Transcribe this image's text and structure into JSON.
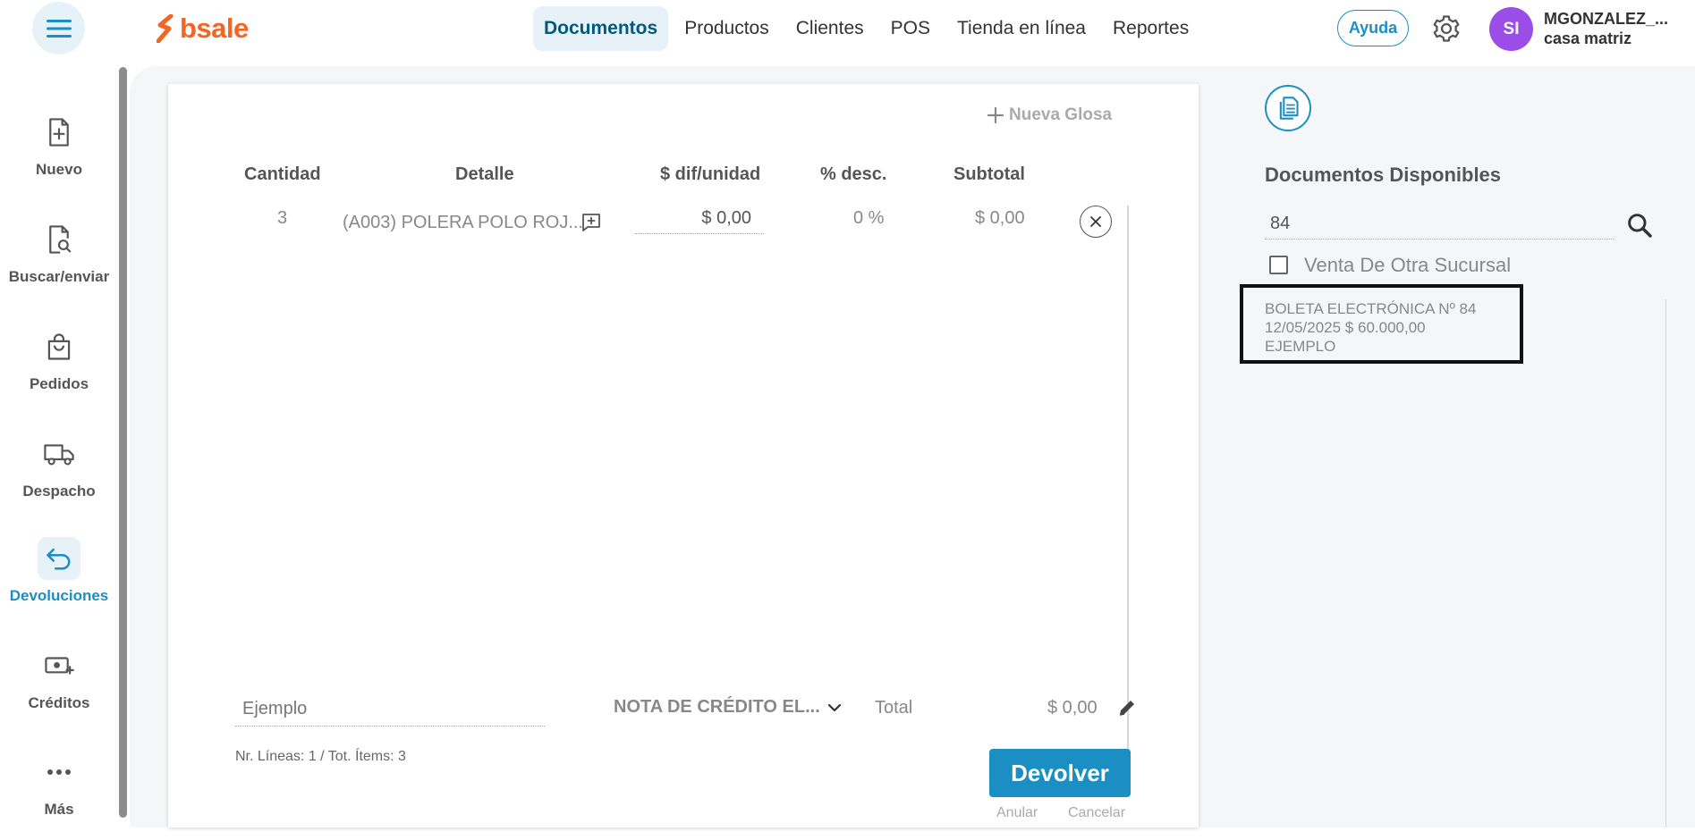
{
  "brand": {
    "name": "bsale",
    "color": "#f26522",
    "accent": "#1b8fc4"
  },
  "nav": {
    "items": [
      {
        "label": "Documentos",
        "active": true
      },
      {
        "label": "Productos"
      },
      {
        "label": "Clientes"
      },
      {
        "label": "POS"
      },
      {
        "label": "Tienda en línea"
      },
      {
        "label": "Reportes"
      }
    ],
    "help_label": "Ayuda"
  },
  "user": {
    "initials": "SI",
    "name": "MGONZALEZ_...",
    "branch": "casa matriz",
    "avatar_color": "#9b4de8"
  },
  "sidebar": {
    "items": [
      {
        "label": "Nuevo",
        "icon": "file-plus-icon"
      },
      {
        "label": "Buscar/enviar",
        "icon": "file-search-icon"
      },
      {
        "label": "Pedidos",
        "icon": "shopping-bag-icon"
      },
      {
        "label": "Despacho",
        "icon": "truck-icon"
      },
      {
        "label": "Devoluciones",
        "icon": "undo-arrow-icon",
        "active": true
      },
      {
        "label": "Créditos",
        "icon": "money-plus-icon"
      },
      {
        "label": "Más",
        "icon": "more-dots-icon"
      }
    ]
  },
  "card": {
    "nueva_glosa": "Nueva Glosa",
    "headers": {
      "cantidad": "Cantidad",
      "detalle": "Detalle",
      "dif_unidad": "$ dif/unidad",
      "desc": "% desc.",
      "subtotal": "Subtotal"
    },
    "rows": [
      {
        "cantidad": "3",
        "detalle": "(A003) POLERA POLO ROJ...",
        "dif_unidad": "$ 0,00",
        "desc": "0 %",
        "subtotal": "$ 0,00"
      }
    ],
    "glosa_value": "Ejemplo",
    "doc_type": "NOTA DE CRÉDITO EL...",
    "total_label": "Total",
    "total_value": "$ 0,00",
    "lines_info": "Nr. Líneas: 1 / Tot. Ítems: 3",
    "devolver_label": "Devolver",
    "anular_label": "Anular",
    "cancelar_label": "Cancelar"
  },
  "panel": {
    "title": "Documentos Disponibles",
    "search_value": "84",
    "checkbox_label": "Venta De Otra Sucursal",
    "results": [
      {
        "line1": "BOLETA ELECTRÓNICA Nº 84",
        "line2": "12/05/2025 $ 60.000,00",
        "line3": "EJEMPLO"
      }
    ]
  }
}
